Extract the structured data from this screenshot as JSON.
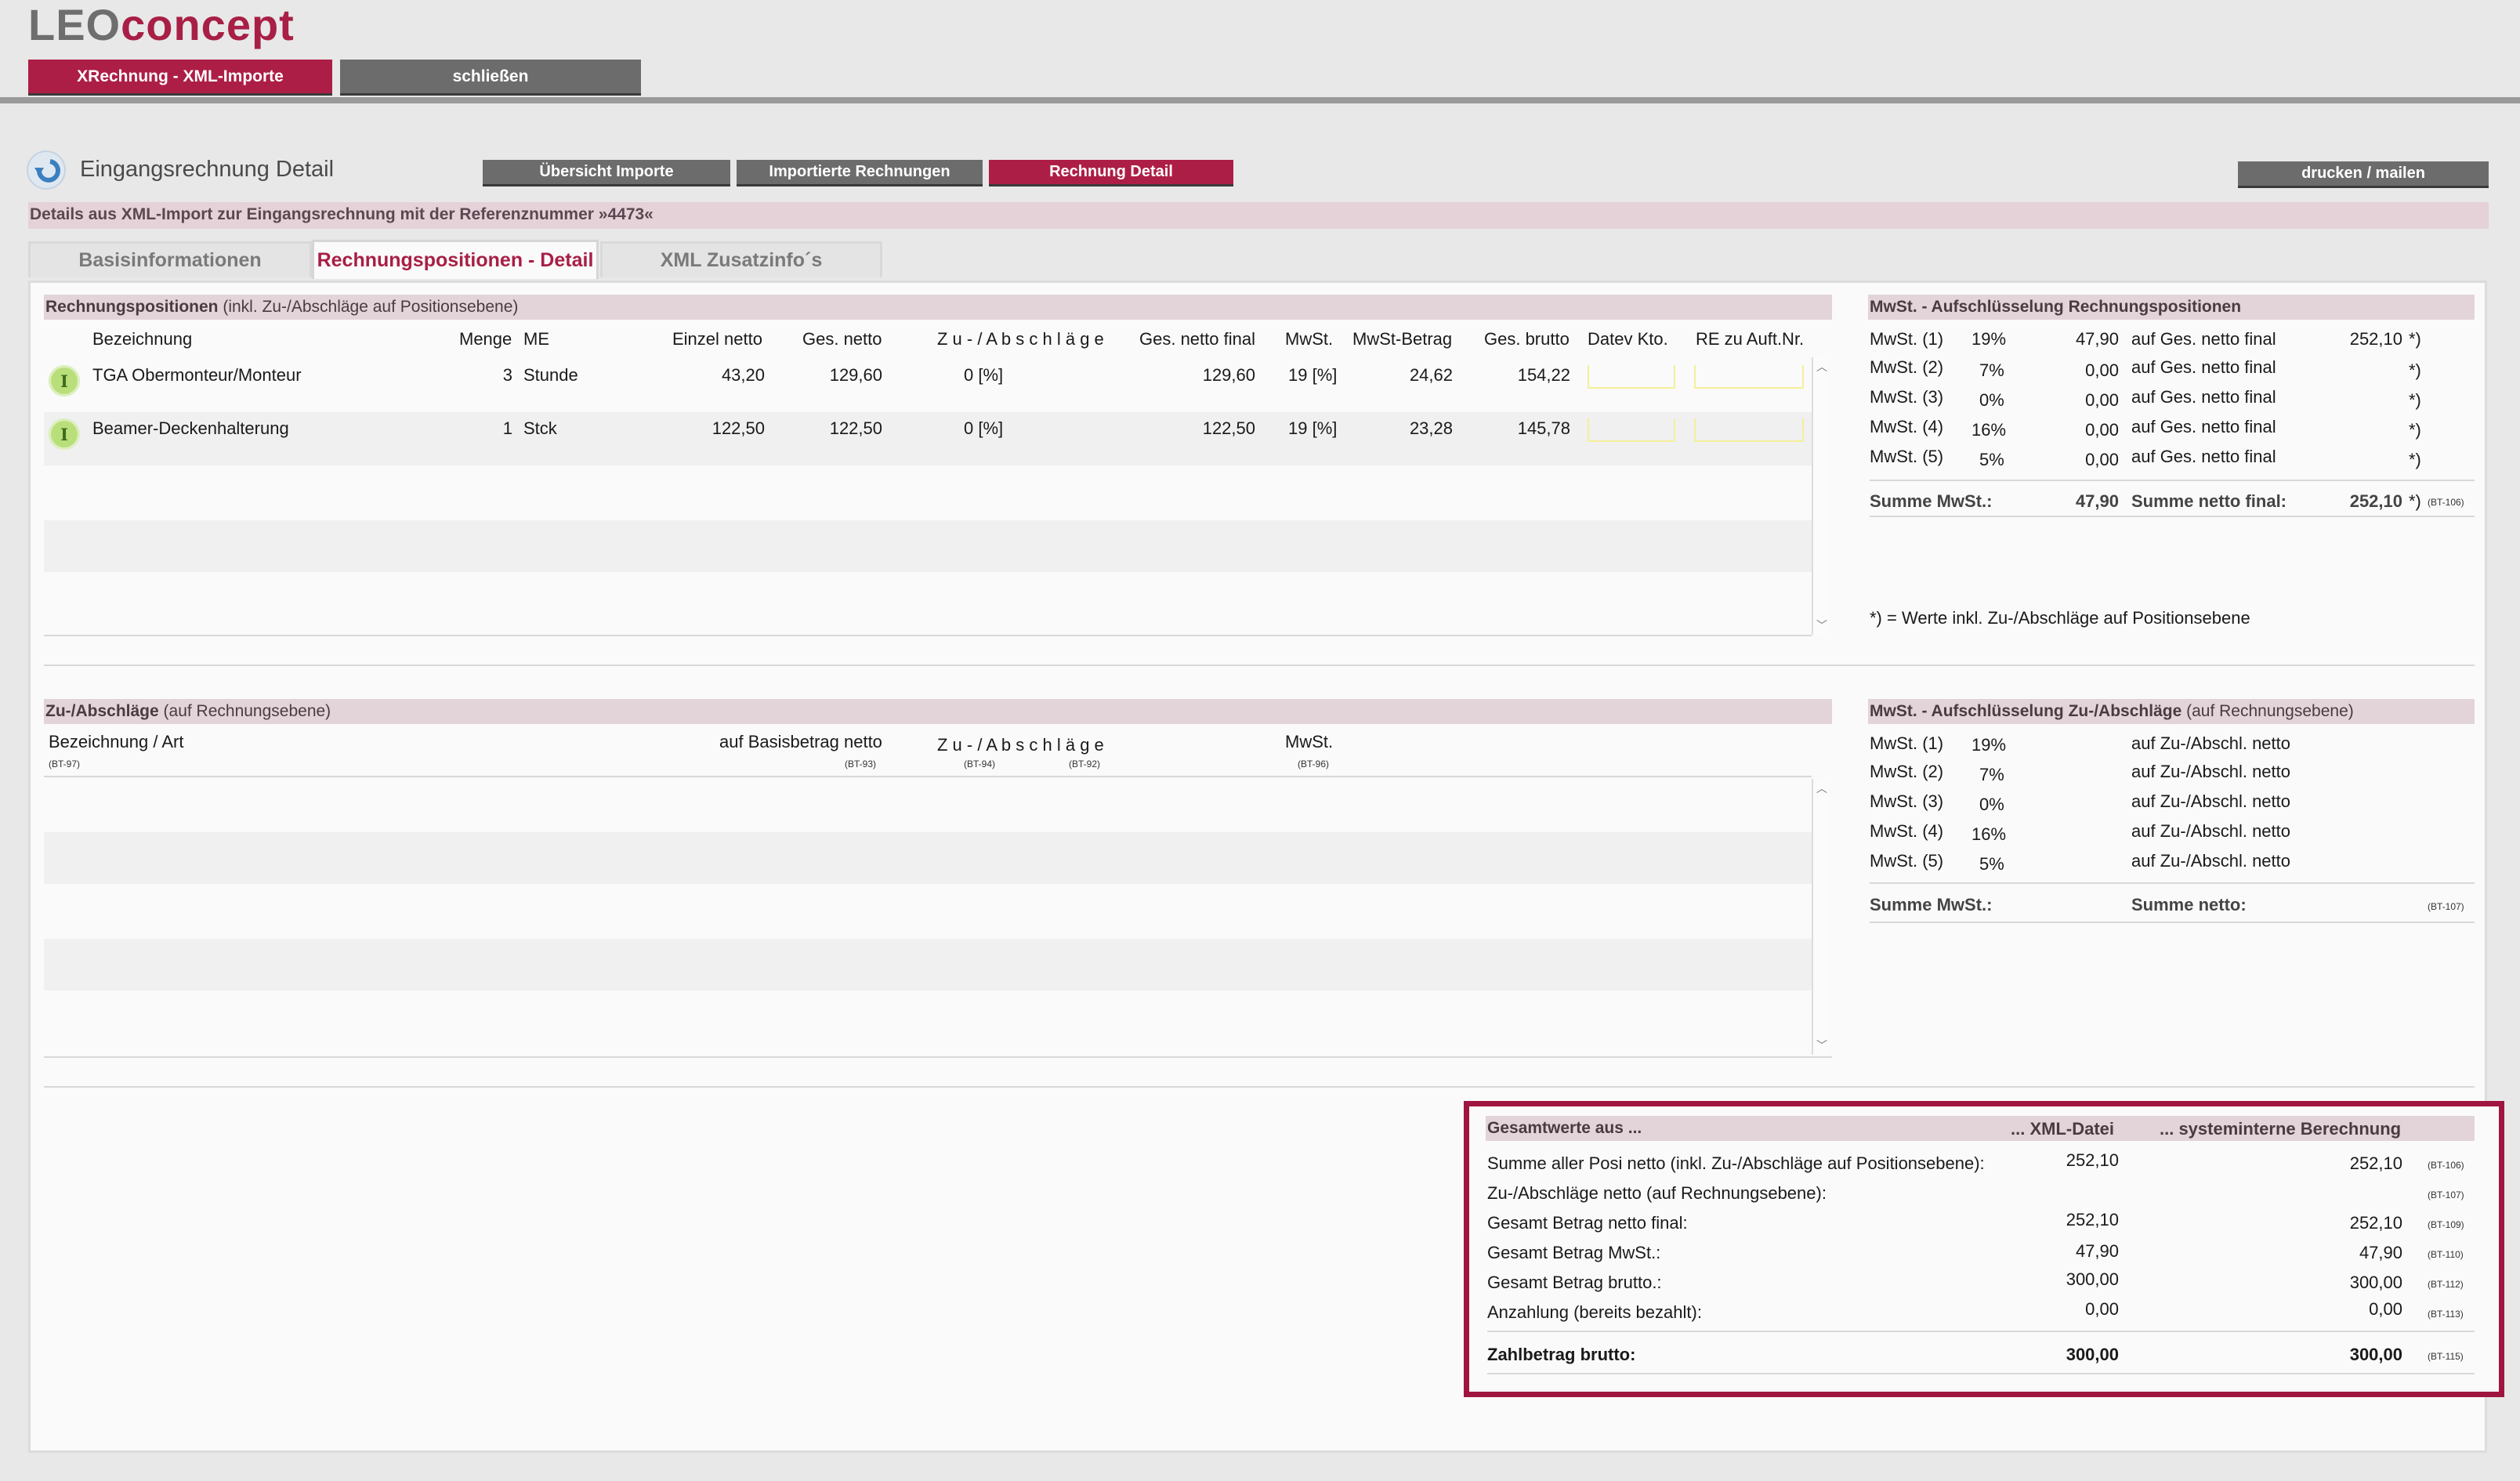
{
  "logo": {
    "part1": "LEO",
    "part2": "concept"
  },
  "topnav": {
    "xrechnung": "XRechnung - XML-Importe",
    "close": "schließen"
  },
  "page": {
    "title": "Eingangsrechnung Detail",
    "nav": [
      "Übersicht Importe",
      "Importierte Rechnungen",
      "Rechnung Detail"
    ],
    "print": "drucken / mailen",
    "subtitle": "Details aus XML-Import zur Eingangsrechnung mit der Referenznummer »4473«"
  },
  "tabs": [
    "Basisinformationen",
    "Rechnungspositionen - Detail",
    "XML Zusatzinfo´s"
  ],
  "positions": {
    "heading_bold": "Rechnungspositionen",
    "heading_rest": " (inkl. Zu-/Abschläge auf Positionsebene)",
    "columns": [
      "Bezeichnung",
      "Menge",
      "ME",
      "Einzel netto",
      "Ges. netto",
      "Z u - / A b s c h l ä g e",
      "Ges. netto final",
      "MwSt.",
      "MwSt-Betrag",
      "Ges. brutto",
      "Datev Kto.",
      "RE zu Auft.Nr."
    ],
    "rows": [
      {
        "icon": "I",
        "name": "TGA Obermonteur/Monteur",
        "qty": "3",
        "unit": "Stunde",
        "unit_net": "43,20",
        "total_net": "129,60",
        "adj": "0 [%]",
        "net_final": "129,60",
        "vat": "19 [%]",
        "vat_amount": "24,62",
        "gross": "154,22"
      },
      {
        "icon": "I",
        "name": "Beamer-Deckenhalterung",
        "qty": "1",
        "unit": "Stck",
        "unit_net": "122,50",
        "total_net": "122,50",
        "adj": "0 [%]",
        "net_final": "122,50",
        "vat": "19 [%]",
        "vat_amount": "23,28",
        "gross": "145,78"
      }
    ]
  },
  "vat_positions": {
    "heading": "MwSt. - Aufschlüsselung Rechnungspositionen",
    "rows": [
      {
        "label": "MwSt. (1)",
        "rate": "19%",
        "amount": "47,90",
        "basis_label": "auf Ges. netto final",
        "basis": "252,10",
        "mark": "*)"
      },
      {
        "label": "MwSt. (2)",
        "rate": "7%",
        "amount": "0,00",
        "basis_label": "auf Ges. netto final",
        "basis": "",
        "mark": "*)"
      },
      {
        "label": "MwSt. (3)",
        "rate": "0%",
        "amount": "0,00",
        "basis_label": "auf Ges. netto final",
        "basis": "",
        "mark": "*)"
      },
      {
        "label": "MwSt. (4)",
        "rate": "16%",
        "amount": "0,00",
        "basis_label": "auf Ges. netto final",
        "basis": "",
        "mark": "*)"
      },
      {
        "label": "MwSt. (5)",
        "rate": "5%",
        "amount": "0,00",
        "basis_label": "auf Ges. netto final",
        "basis": "",
        "mark": "*)"
      }
    ],
    "sum_label": "Summe MwSt.:",
    "sum_value": "47,90",
    "net_label": "Summe netto final:",
    "net_value": "252,10",
    "net_mark": "*)",
    "net_code": "(BT-106)",
    "footnote": "*) = Werte inkl. Zu-/Abschläge auf Positionsebene"
  },
  "charges": {
    "heading_bold": "Zu-/Abschläge",
    "heading_rest": " (auf Rechnungsebene)",
    "col_name": "Bezeichnung / Art",
    "col_name_code": "(BT-97)",
    "col_base": "auf Basisbetrag netto",
    "col_base_code": "(BT-93)",
    "col_adj": "Z u - / A b s c h l ä g e",
    "col_adj_code1": "(BT-94)",
    "col_adj_code2": "(BT-92)",
    "col_vat": "MwSt.",
    "col_vat_code": "(BT-96)"
  },
  "vat_charges": {
    "heading_bold": "MwSt. - Aufschlüsselung Zu-/Abschläge",
    "heading_rest": " (auf Rechnungsebene)",
    "rows": [
      {
        "label": "MwSt. (1)",
        "rate": "19%",
        "basis_label": "auf Zu-/Abschl. netto"
      },
      {
        "label": "MwSt. (2)",
        "rate": "7%",
        "basis_label": "auf Zu-/Abschl. netto"
      },
      {
        "label": "MwSt. (3)",
        "rate": "0%",
        "basis_label": "auf Zu-/Abschl. netto"
      },
      {
        "label": "MwSt. (4)",
        "rate": "16%",
        "basis_label": "auf Zu-/Abschl. netto"
      },
      {
        "label": "MwSt. (5)",
        "rate": "5%",
        "basis_label": "auf Zu-/Abschl. netto"
      }
    ],
    "sum_label": "Summe MwSt.:",
    "net_label": "Summe netto:",
    "net_code": "(BT-107)"
  },
  "totals": {
    "h_label": "Gesamtwerte aus ...",
    "h_xml": "... XML-Datei",
    "h_sys": "... systeminterne Berechnung",
    "rows": [
      {
        "label": "Summe aller Posi netto (inkl. Zu-/Abschläge auf Positionsebene):",
        "xml": "252,10",
        "sys": "252,10",
        "code": "(BT-106)"
      },
      {
        "label": "Zu-/Abschläge netto (auf Rechnungsebene):",
        "xml": "",
        "sys": "",
        "code": "(BT-107)"
      },
      {
        "label": "Gesamt Betrag netto final:",
        "xml": "252,10",
        "sys": "252,10",
        "code": "(BT-109)"
      },
      {
        "label": "Gesamt Betrag MwSt.:",
        "xml": "47,90",
        "sys": "47,90",
        "code": "(BT-110)"
      },
      {
        "label": "Gesamt Betrag brutto.:",
        "xml": "300,00",
        "sys": "300,00",
        "code": "(BT-112)"
      },
      {
        "label": "Anzahlung (bereits bezahlt):",
        "xml": "0,00",
        "sys": "0,00",
        "code": "(BT-113)"
      }
    ],
    "final": {
      "label": "Zahlbetrag brutto:",
      "xml": "300,00",
      "sys": "300,00",
      "code": "(BT-115)"
    }
  }
}
